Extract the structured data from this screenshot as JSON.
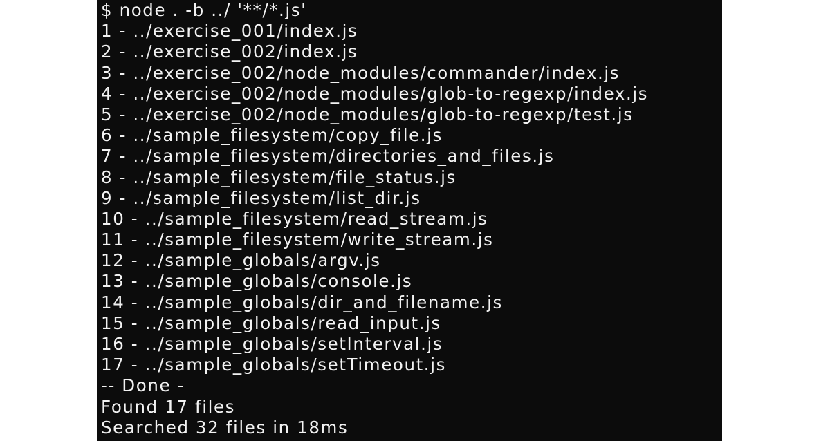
{
  "terminal": {
    "lines": [
      "$ node . -b ../ '**/*.js'",
      "1 - ../exercise_001/index.js",
      "2 - ../exercise_002/index.js",
      "3 - ../exercise_002/node_modules/commander/index.js",
      "4 - ../exercise_002/node_modules/glob-to-regexp/index.js",
      "5 - ../exercise_002/node_modules/glob-to-regexp/test.js",
      "6 - ../sample_filesystem/copy_file.js",
      "7 - ../sample_filesystem/directories_and_files.js",
      "8 - ../sample_filesystem/file_status.js",
      "9 - ../sample_filesystem/list_dir.js",
      "10 - ../sample_filesystem/read_stream.js",
      "11 - ../sample_filesystem/write_stream.js",
      "12 - ../sample_globals/argv.js",
      "13 - ../sample_globals/console.js",
      "14 - ../sample_globals/dir_and_filename.js",
      "15 - ../sample_globals/read_input.js",
      "16 - ../sample_globals/setInterval.js",
      "17 - ../sample_globals/setTimeout.js",
      "-- Done -",
      "Found 17 files",
      "Searched 32 files in 18ms"
    ],
    "colors": {
      "background": "#0c0c0c",
      "text": "#f2f2f2"
    }
  }
}
